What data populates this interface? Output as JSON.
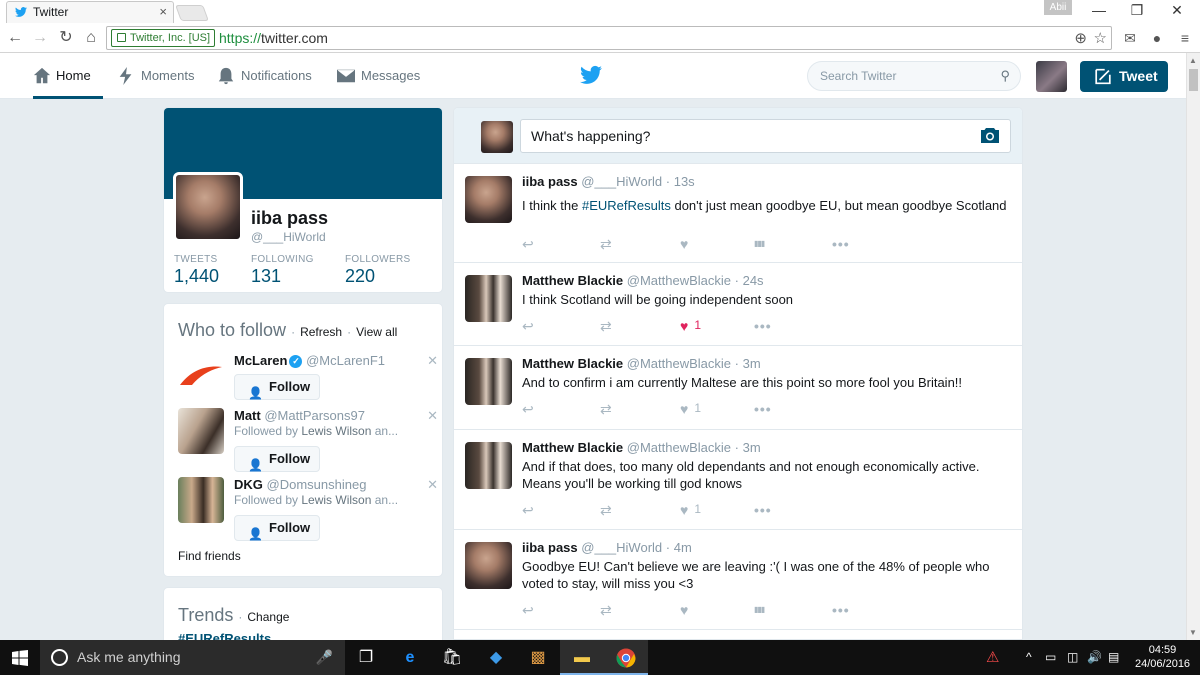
{
  "browser": {
    "tab_title": "Twitter",
    "profile_label": "Abii",
    "secure_label": "Twitter, Inc. [US]",
    "url_scheme": "https://",
    "url_host": "twitter.com"
  },
  "nav": {
    "home": "Home",
    "moments": "Moments",
    "notifications": "Notifications",
    "messages": "Messages",
    "search_placeholder": "Search Twitter",
    "tweet_button": "Tweet"
  },
  "profile": {
    "name": "iiba pass",
    "handle": "@___HiWorld",
    "stats": [
      {
        "label": "TWEETS",
        "value": "1,440"
      },
      {
        "label": "FOLLOWING",
        "value": "131"
      },
      {
        "label": "FOLLOWERS",
        "value": "220"
      }
    ]
  },
  "who_to_follow": {
    "title": "Who to follow",
    "sep": "·",
    "refresh": "Refresh",
    "view_all": "View all",
    "follow_label": "Follow",
    "suggestions": [
      {
        "name": "McLaren",
        "handle": "@McLarenF1",
        "sub_prefix": "",
        "sub_name": "",
        "sub_suffix": ""
      },
      {
        "name": "Matt",
        "handle": "@MattParsons97",
        "sub_prefix": "Followed by ",
        "sub_name": "Lewis Wilson",
        "sub_suffix": " an..."
      },
      {
        "name": "DKG",
        "handle": "@Domsunshineg",
        "sub_prefix": "Followed by ",
        "sub_name": "Lewis Wilson",
        "sub_suffix": " an..."
      }
    ],
    "find_friends": "Find friends"
  },
  "trends": {
    "title": "Trends",
    "change": "Change",
    "first": "#EURefResults"
  },
  "compose": {
    "placeholder": "What's happening?"
  },
  "tweets": [
    {
      "name": "iiba pass",
      "handle": "@___HiWorld",
      "time": "13s",
      "text_before": "I think the ",
      "hashtag": "#EURefResults",
      "text_after": " don't just mean goodbye EU, but mean goodbye Scotland",
      "likes": "",
      "liked": false,
      "analytics": true
    },
    {
      "name": "Matthew Blackie",
      "handle": "@MatthewBlackie",
      "time": "24s",
      "text_before": "I think Scotland will be going independent soon",
      "hashtag": "",
      "text_after": "",
      "likes": "1",
      "liked": true,
      "analytics": false
    },
    {
      "name": "Matthew Blackie",
      "handle": "@MatthewBlackie",
      "time": "3m",
      "text_before": "And to confirm i am currently Maltese are this point so more fool you Britain!!",
      "hashtag": "",
      "text_after": "",
      "likes": "1",
      "liked": false,
      "analytics": false
    },
    {
      "name": "Matthew Blackie",
      "handle": "@MatthewBlackie",
      "time": "3m",
      "text_before": "And if that does, too many old dependants and not enough economically active. Means you'll be working till god knows",
      "hashtag": "",
      "text_after": "",
      "likes": "1",
      "liked": false,
      "analytics": false
    },
    {
      "name": "iiba pass",
      "handle": "@___HiWorld",
      "time": "4m",
      "text_before": "Goodbye EU! Can't believe we are leaving :'( I was one of the 48% of people who voted to stay, will miss you <3",
      "hashtag": "",
      "text_after": "",
      "likes": "",
      "liked": false,
      "analytics": true
    }
  ],
  "taskbar": {
    "search_placeholder": "Ask me anything",
    "time": "04:59",
    "date": "24/06/2016"
  },
  "colors": {
    "brand": "#005274",
    "twitter_blue": "#1da1f2",
    "like_red": "#e0245e"
  }
}
